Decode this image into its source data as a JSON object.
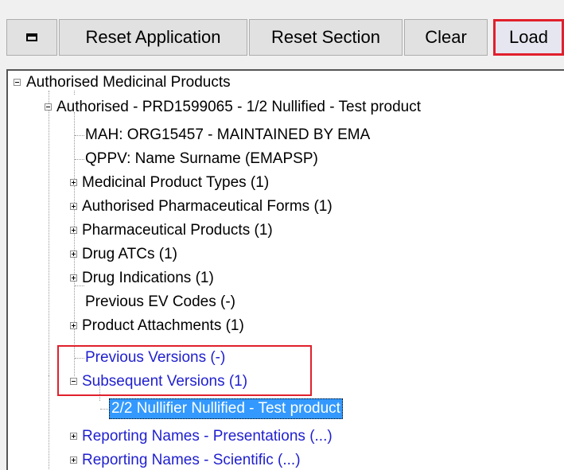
{
  "toolbar": {
    "window_icon": "window-icon",
    "reset_application_label": "Reset Application",
    "reset_section_label": "Reset Section",
    "clear_label": "Clear",
    "load_label": "Load",
    "highlight_color": "#e0202c"
  },
  "tree": {
    "root": "Authorised Medicinal Products",
    "product": "Authorised - PRD1599065 - 1/2  Nullified - Test product",
    "mah": "MAH: ORG15457 - MAINTAINED BY EMA",
    "qppv": "QPPV:  Name Surname (EMAPSP)",
    "medicinal_product_types": "Medicinal Product Types (1)",
    "pharmaceutical_forms": "Authorised Pharmaceutical Forms (1)",
    "pharmaceutical_products": "Pharmaceutical Products (1)",
    "drug_atcs": "Drug ATCs (1)",
    "drug_indications": "Drug Indications (1)",
    "previous_ev_codes": "Previous EV Codes (-)",
    "product_attachments": "Product Attachments (1)",
    "previous_versions": "Previous Versions (-)",
    "subsequent_versions": "Subsequent Versions (1)",
    "selected_child": "2/2 Nullifier Nullified - Test product",
    "reporting_presentations": "Reporting Names - Presentations (...)",
    "reporting_scientific": "Reporting Names - Scientific (...)",
    "link_color": "#1f1fcf",
    "selection_color": "#3399ff"
  }
}
